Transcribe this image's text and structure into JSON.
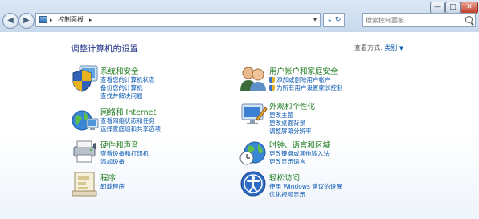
{
  "window": {
    "min": "—",
    "max": "□",
    "close": "✕"
  },
  "nav": {
    "back": "◀",
    "forward": "▶"
  },
  "address": {
    "sep1": "▸",
    "path": "控制面板",
    "sep2": "▸",
    "dropdown": "▾"
  },
  "refresh": "↓ ↻",
  "search": {
    "placeholder": "搜索控制面板"
  },
  "heading": "调整计算机的设置",
  "view_by": {
    "label": "查看方式:",
    "value": "类别",
    "caret": "▼"
  },
  "categories": [
    {
      "title": "系统和安全",
      "links": [
        "查看您的计算机状态",
        "备份您的计算机",
        "查找并解决问题"
      ]
    },
    {
      "title": "网络和 Internet",
      "links": [
        "查看网络状态和任务",
        "选择家庭组和共享选项"
      ]
    },
    {
      "title": "硬件和声音",
      "links": [
        "查看设备和打印机",
        "添加设备"
      ]
    },
    {
      "title": "程序",
      "links": [
        "卸载程序"
      ]
    },
    {
      "title": "用户帐户和家庭安全",
      "links": [
        "添加或删除用户帐户",
        "为所有用户设置家长控制"
      ]
    },
    {
      "title": "外观和个性化",
      "links": [
        "更改主题",
        "更改桌面背景",
        "调整屏幕分辨率"
      ]
    },
    {
      "title": "时钟、语言和区域",
      "links": [
        "更改键盘或其他输入法",
        "更改显示语言"
      ]
    },
    {
      "title": "轻松访问",
      "links": [
        "使用 Windows 建议的设置",
        "优化视频显示"
      ]
    }
  ],
  "icons": [
    "system-security-icon",
    "network-internet-icon",
    "hardware-sound-icon",
    "programs-icon",
    "user-accounts-icon",
    "appearance-icon",
    "clock-language-icon",
    "ease-of-access-icon"
  ],
  "colors": {
    "category_title": "#1f7a1f",
    "link": "#0b59b3",
    "heading": "#1e3287"
  }
}
